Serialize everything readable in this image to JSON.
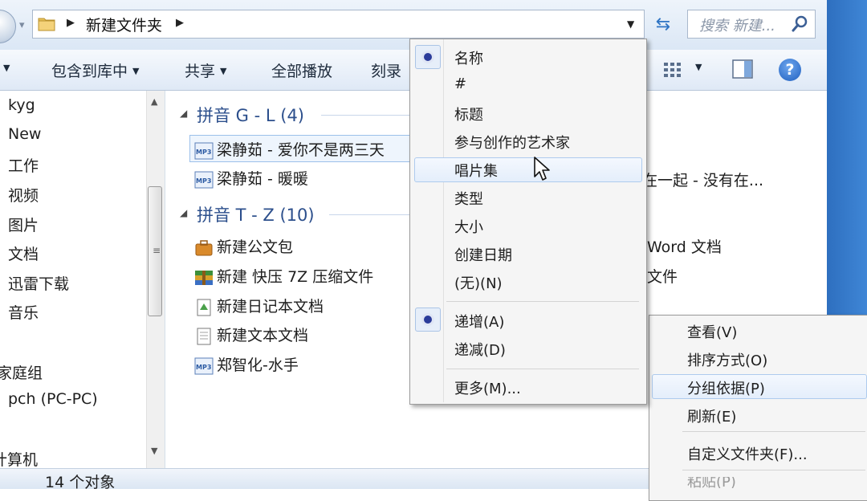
{
  "address": {
    "folder": "新建文件夹",
    "search_placeholder": "搜索 新建..."
  },
  "toolbar": {
    "include_library": "包含到库中",
    "share": "共享",
    "play_all": "全部播放",
    "burn": "刻录"
  },
  "nav": {
    "items": [
      "kyg",
      "New",
      "工作",
      "视频",
      "图片",
      "文档",
      "迅雷下载",
      "音乐"
    ],
    "homegroup": "家庭组",
    "network_pc": "pch (PC-PC)",
    "computer": "计算机"
  },
  "groups": [
    {
      "title": "拼音 G - L (4)",
      "files": [
        "梁静茹 - 爱你不是两三天",
        "梁静茹 - 暖暖"
      ],
      "partial_right": "在一起 - 没有在..."
    },
    {
      "title": "拼音 T - Z (10)",
      "files": [
        "新建公文包",
        "新建 快压 7Z 压缩文件",
        "新建日记本文档",
        "新建文本文档",
        "郑智化-水手"
      ],
      "partial_right": [
        "Word 文档",
        "文件"
      ]
    }
  ],
  "group_by_menu": {
    "items": [
      "名称",
      "#",
      "标题",
      "参与创作的艺术家",
      "唱片集",
      "类型",
      "大小",
      "创建日期",
      "(无)(N)"
    ],
    "selected": "名称",
    "hovered": "唱片集",
    "order": [
      "递增(A)",
      "递减(D)"
    ],
    "order_selected": "递增(A)",
    "more": "更多(M)..."
  },
  "context_menu": {
    "items": [
      "查看(V)",
      "排序方式(O)",
      "分组依据(P)",
      "刷新(E)",
      "自定义文件夹(F)..."
    ],
    "hovered": "分组依据(P)",
    "partial_bottom": "粘贴(P)"
  },
  "status": {
    "count": "14 个对象"
  },
  "colors": {
    "group_header": "#2c4f8c",
    "accent_blue": "#3f86d6",
    "bullet": "#2b3c9a"
  }
}
